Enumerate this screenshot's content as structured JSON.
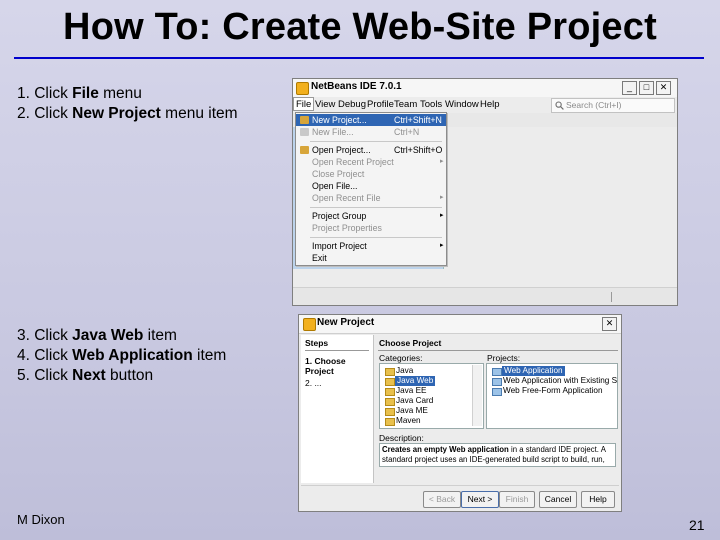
{
  "slide": {
    "title": "How To: Create Web-Site Project",
    "steps_top": [
      {
        "prefix": "1. Click ",
        "bold": "File",
        "suffix": " menu"
      },
      {
        "prefix": "2. Click ",
        "bold": "New Project",
        "suffix": " menu item"
      }
    ],
    "steps_bottom": [
      {
        "prefix": "3. Click ",
        "bold": "Java Web",
        "suffix": " item"
      },
      {
        "prefix": "4. Click ",
        "bold": "Web Application",
        "suffix": " item"
      },
      {
        "prefix": "5. Click ",
        "bold": "Next",
        "suffix": " button"
      }
    ],
    "author": "M Dixon",
    "page_number": "21",
    "colors": {
      "title_rule": "#0000cc",
      "selection": "#2e65b3",
      "workspace": "#bcd3eb"
    }
  },
  "ide": {
    "title": "NetBeans IDE 7.0.1",
    "window_buttons": [
      "_",
      "□",
      "✕"
    ],
    "menus": [
      "File",
      "View",
      "Debug",
      "Profile",
      "Team",
      "Tools",
      "Window",
      "Help"
    ],
    "search_placeholder": "Search (Ctrl+I)",
    "file_menu": [
      {
        "label": "New Project...",
        "shortcut": "Ctrl+Shift+N",
        "selected": true
      },
      {
        "label": "New File...",
        "shortcut": "Ctrl+N",
        "disabled": true
      },
      {
        "separator": true
      },
      {
        "label": "Open Project...",
        "shortcut": "Ctrl+Shift+O"
      },
      {
        "label": "Open Recent Project",
        "submenu": true,
        "disabled": true
      },
      {
        "label": "Close Project",
        "disabled": true
      },
      {
        "label": "Open File..."
      },
      {
        "label": "Open Recent File",
        "submenu": true,
        "disabled": true
      },
      {
        "separator": true
      },
      {
        "label": "Project Group",
        "submenu": true
      },
      {
        "label": "Project Properties",
        "disabled": true
      },
      {
        "separator": true
      },
      {
        "label": "Import Project",
        "submenu": true
      },
      {
        "label": "Exit"
      }
    ]
  },
  "dialog": {
    "title": "New Project",
    "close": "✕",
    "steps_heading": "Steps",
    "step1": "1. Choose Project",
    "step2": "2. ...",
    "main_heading": "Choose Project",
    "categories_label": "Categories:",
    "projects_label": "Projects:",
    "categories": [
      {
        "label": "Java"
      },
      {
        "label": "Java Web",
        "selected": true
      },
      {
        "label": "Java EE"
      },
      {
        "label": "Java Card"
      },
      {
        "label": "Java ME"
      },
      {
        "label": "Maven"
      }
    ],
    "projects": [
      {
        "label": "Web Application",
        "selected": true
      },
      {
        "label": "Web Application with Existing Sources"
      },
      {
        "label": "Web Free-Form Application"
      }
    ],
    "description_label": "Description:",
    "description_bold": "Creates an empty Web application",
    "description_rest": " in a standard IDE project. A standard project uses an IDE-generated build script to build, run, and debug your project.",
    "buttons": {
      "back": "< Back",
      "next": "Next >",
      "finish": "Finish",
      "cancel": "Cancel",
      "help": "Help"
    }
  }
}
